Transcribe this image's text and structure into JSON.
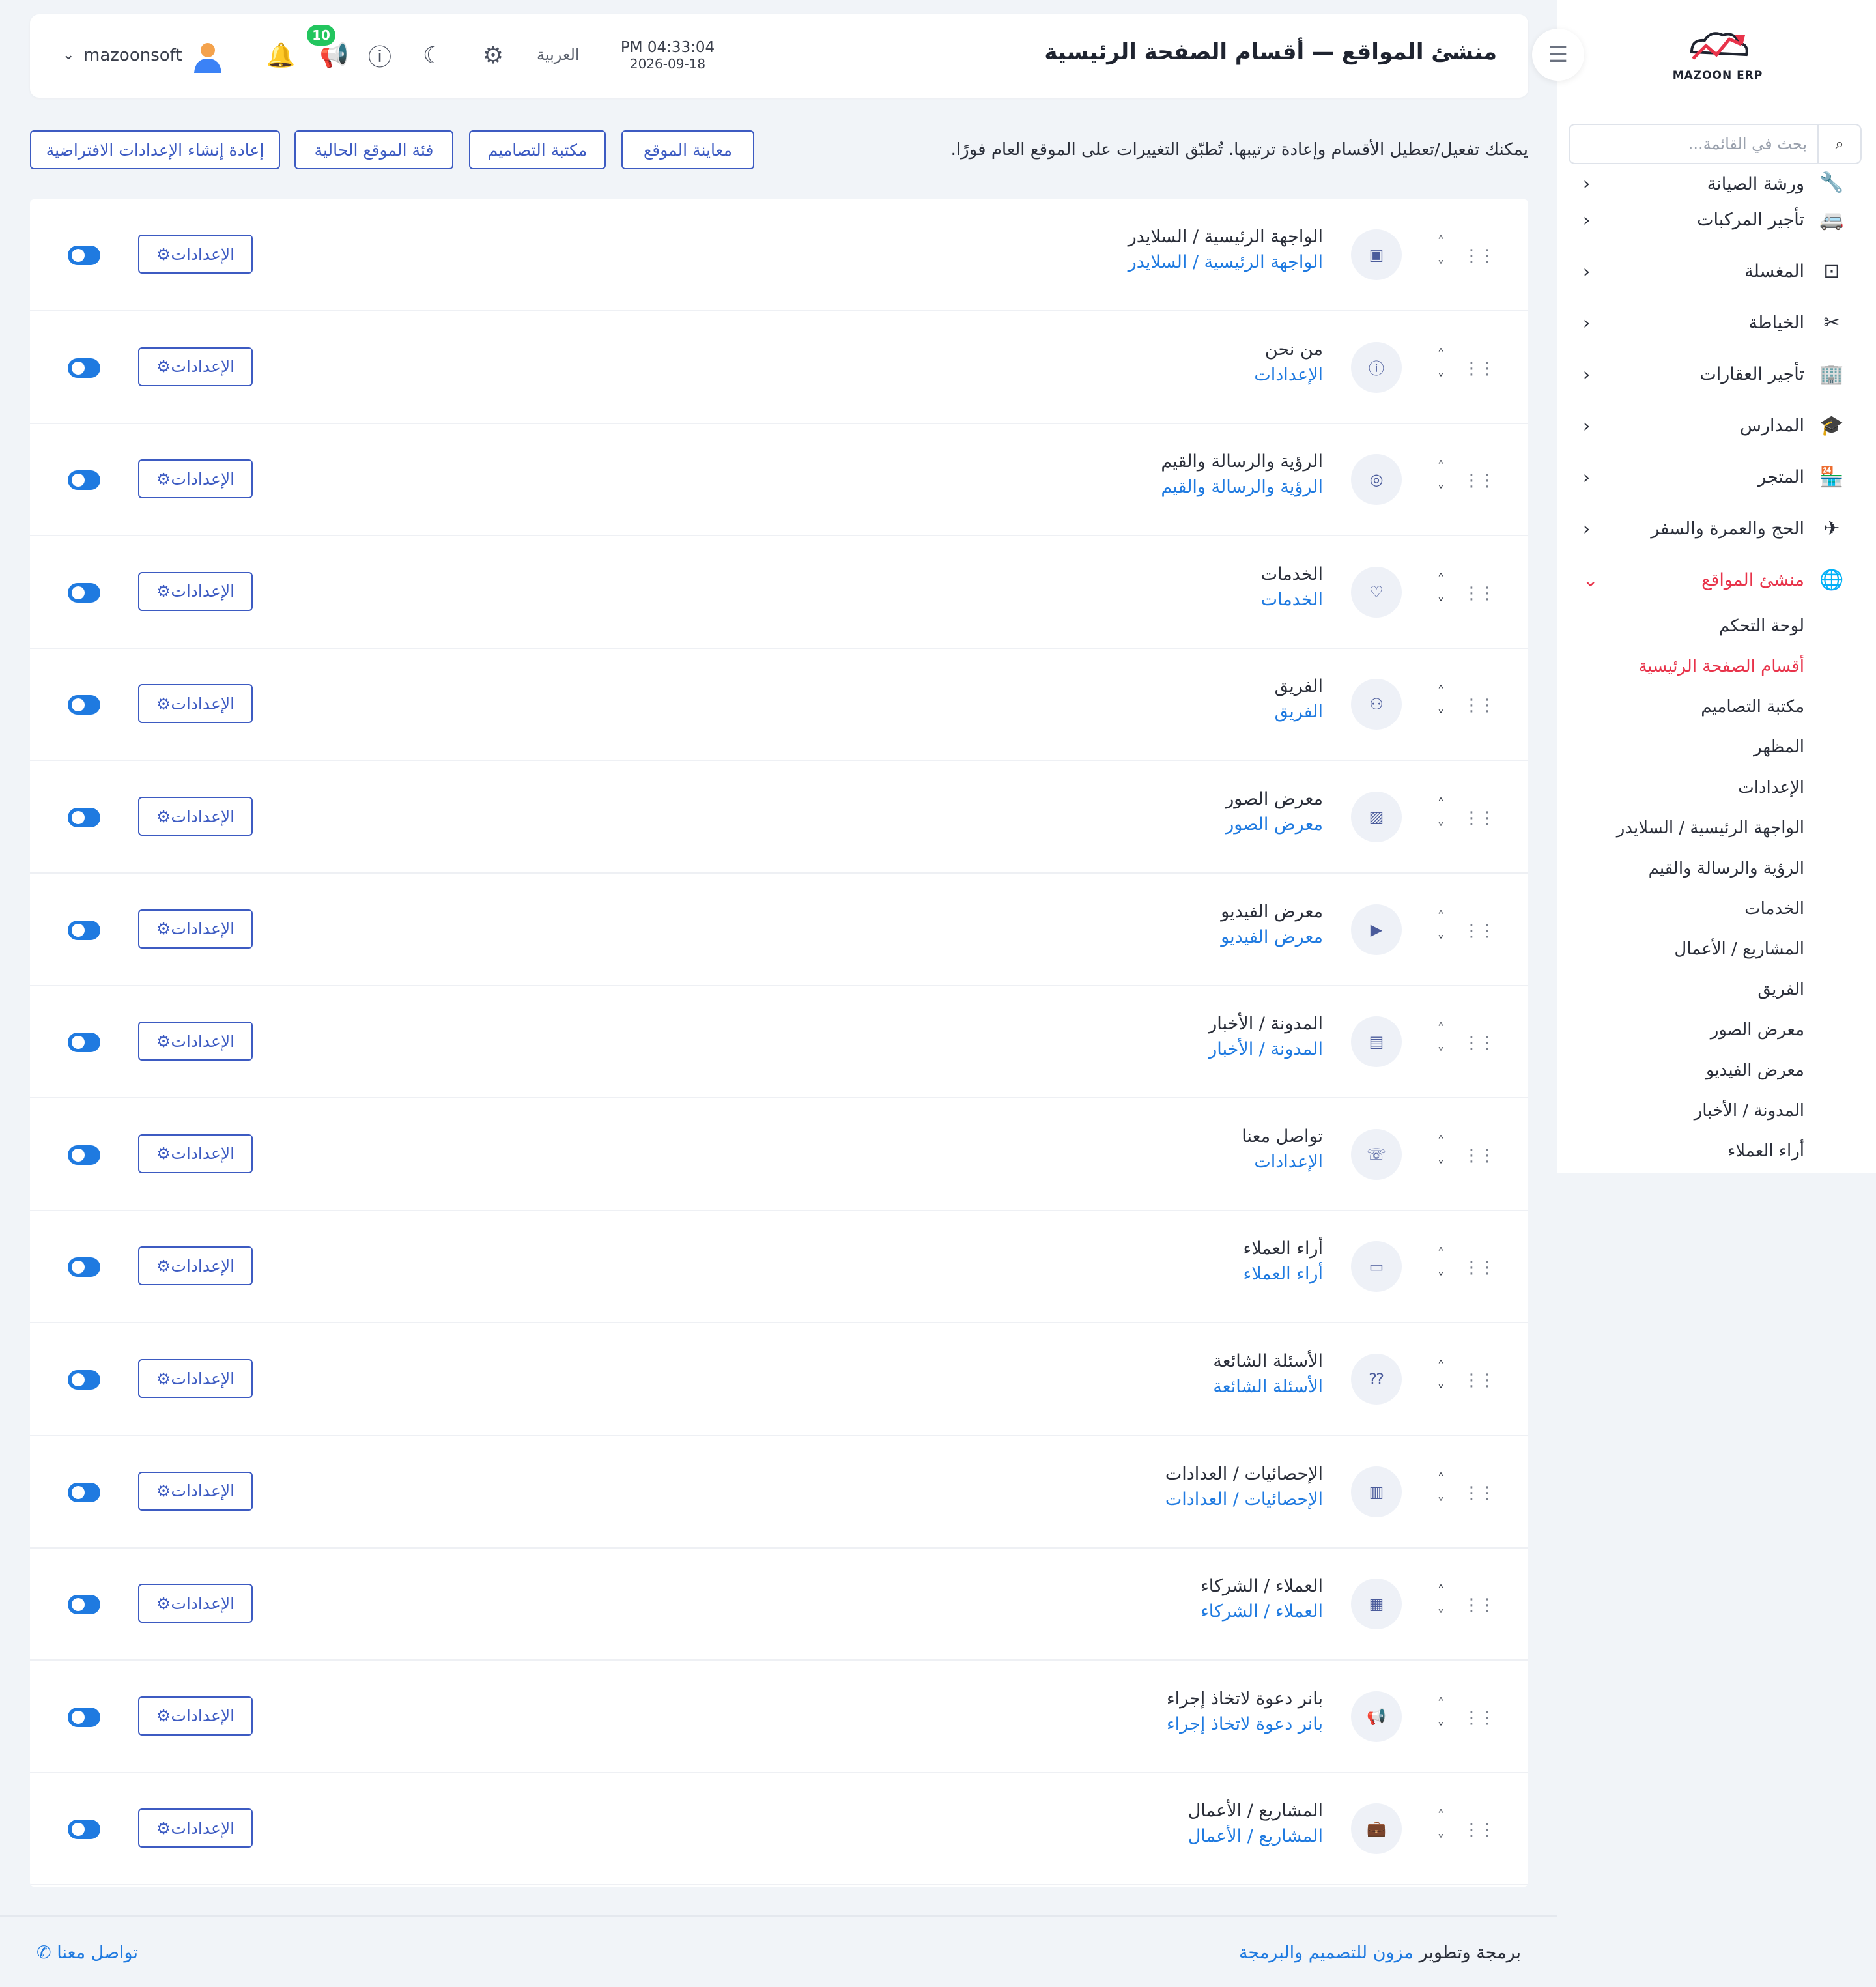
{
  "sidebar": {
    "logo_text": "MAZOON ERP",
    "search_placeholder": "بحث في القائمة...",
    "items": [
      {
        "label": "ورشة الصيانة",
        "icon": "wrench-icon",
        "glyph": "🔧"
      },
      {
        "label": "تأجير المركبات",
        "icon": "car-icon",
        "glyph": "🚐"
      },
      {
        "label": "المغسلة",
        "icon": "washing-machine-icon",
        "glyph": "⊡"
      },
      {
        "label": "الخياطة",
        "icon": "needle-icon",
        "glyph": "✂"
      },
      {
        "label": "تأجير العقارات",
        "icon": "building-icon",
        "glyph": "🏢"
      },
      {
        "label": "المدارس",
        "icon": "graduation-cap-icon",
        "glyph": "🎓"
      },
      {
        "label": "المتجر",
        "icon": "store-icon",
        "glyph": "🏪"
      },
      {
        "label": "الحج والعمرة والسفر",
        "icon": "plane-icon",
        "glyph": "✈"
      },
      {
        "label": "منشئ المواقع",
        "icon": "globe-icon",
        "glyph": "🌐"
      }
    ],
    "sub_items": [
      "لوحة التحكم",
      "أقسام الصفحة الرئيسية",
      "مكتبة التصاميم",
      "المظهر",
      "الإعدادات",
      "الواجهة الرئيسية / السلايدر",
      "الرؤية والرسالة والقيم",
      "الخدمات",
      "المشاريع / الأعمال",
      "الفريق",
      "معرض الصور",
      "معرض الفيديو",
      "المدونة / الأخبار",
      "أراء العملاء"
    ],
    "active_sub_index": 1
  },
  "header": {
    "title": "منشئ المواقع — أقسام الصفحة الرئيسية",
    "time": "PM 04:33:04",
    "date": "2026-09-18",
    "language": "العربية",
    "notification_count": "10",
    "username": "mazoonsoft"
  },
  "toolbar": {
    "hint": "يمكنك تفعيل/تعطيل الأقسام وإعادة ترتيبها. تُطبّق التغييرات على الموقع العام فورًا.",
    "preview_label": "معاينة الموقع",
    "library_label": "مكتبة التصاميم",
    "category_label": "فئة الموقع الحالية",
    "reset_label": "إعادة إنشاء الإعدادات الافتراضية"
  },
  "settings_label": "الإعدادات",
  "sections": [
    {
      "name": "الواجهة الرئيسية / السلايدر",
      "subtitle": "الواجهة الرئيسية / السلايدر",
      "icon": "image-icon",
      "glyph": "▣",
      "enabled": true
    },
    {
      "name": "من نحن",
      "subtitle": "الإعدادات",
      "icon": "info-icon",
      "glyph": "ⓘ",
      "enabled": true
    },
    {
      "name": "الرؤية والرسالة والقيم",
      "subtitle": "الرؤية والرسالة والقيم",
      "icon": "compass-icon",
      "glyph": "◎",
      "enabled": true
    },
    {
      "name": "الخدمات",
      "subtitle": "الخدمات",
      "icon": "heart-hand-icon",
      "glyph": "♡",
      "enabled": true
    },
    {
      "name": "الفريق",
      "subtitle": "الفريق",
      "icon": "users-icon",
      "glyph": "⚇",
      "enabled": true
    },
    {
      "name": "معرض الصور",
      "subtitle": "معرض الصور",
      "icon": "gallery-icon",
      "glyph": "▨",
      "enabled": true
    },
    {
      "name": "معرض الفيديو",
      "subtitle": "معرض الفيديو",
      "icon": "video-icon",
      "glyph": "▶",
      "enabled": true
    },
    {
      "name": "المدونة / الأخبار",
      "subtitle": "المدونة / الأخبار",
      "icon": "newspaper-icon",
      "glyph": "▤",
      "enabled": true
    },
    {
      "name": "تواصل معنا",
      "subtitle": "الإعدادات",
      "icon": "headset-icon",
      "glyph": "☏",
      "enabled": true
    },
    {
      "name": "أراء العملاء",
      "subtitle": "أراء العملاء",
      "icon": "chat-icon",
      "glyph": "▭",
      "enabled": true
    },
    {
      "name": "الأسئلة الشائعة",
      "subtitle": "الأسئلة الشائعة",
      "icon": "faq-icon",
      "glyph": "⁇",
      "enabled": true
    },
    {
      "name": "الإحصائيات / العدادات",
      "subtitle": "الإحصائيات / العدادات",
      "icon": "bar-chart-icon",
      "glyph": "▥",
      "enabled": true
    },
    {
      "name": "العملاء / الشركاء",
      "subtitle": "العملاء / الشركاء",
      "icon": "building-icon",
      "glyph": "▦",
      "enabled": true
    },
    {
      "name": "بانر دعوة لاتخاذ إجراء",
      "subtitle": "بانر دعوة لاتخاذ إجراء",
      "icon": "megaphone-icon",
      "glyph": "📢",
      "enabled": true
    },
    {
      "name": "المشاريع / الأعمال",
      "subtitle": "المشاريع / الأعمال",
      "icon": "briefcase-icon",
      "glyph": "💼",
      "enabled": true
    }
  ],
  "footer": {
    "credit_prefix": "برمجة وتطوير",
    "credit_link": "مزون للتصميم والبرمجة",
    "contact": "تواصل معنا"
  },
  "colors": {
    "accent": "#3d5bc2",
    "link": "#1f7ae0",
    "active": "#e8334a",
    "badge": "#22c55e"
  }
}
